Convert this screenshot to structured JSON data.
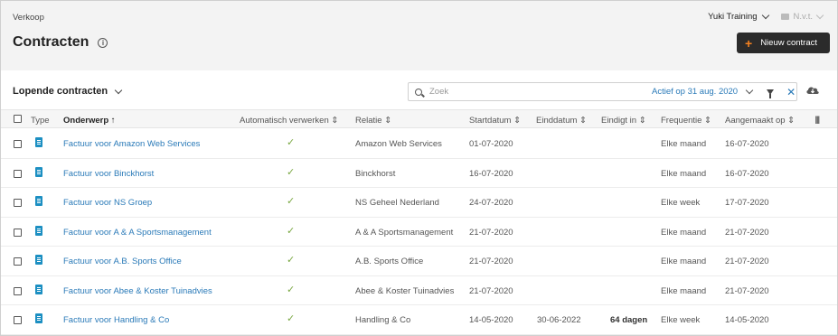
{
  "header": {
    "breadcrumb": "Verkoop",
    "title": "Contracten",
    "info_glyph": "i",
    "company": "Yuki Training",
    "period": "N.v.t.",
    "new_button": "Nieuw contract",
    "new_button_glyph": "+"
  },
  "toolbar": {
    "list_selector": "Lopende contracten",
    "search_placeholder": "Zoek",
    "active_filter": "Actief op 31 aug. 2020",
    "clear_glyph": "✕"
  },
  "table": {
    "columns": {
      "type": "Type",
      "onderwerp": "Onderwerp ↑",
      "auto": "Automatisch verwerken ⇕",
      "relatie": "Relatie ⇕",
      "start": "Startdatum ⇕",
      "eind": "Einddatum ⇕",
      "eindigt": "Eindigt in ⇕",
      "freq": "Frequentie ⇕",
      "aangemaakt": "Aangemaakt op ⇕",
      "colsel": "|||"
    },
    "check_glyph": "✓",
    "rows": [
      {
        "onderwerp": "Factuur voor Amazon Web Services",
        "relatie": "Amazon Web Services",
        "start": "01-07-2020",
        "eind": "",
        "eindigt": "",
        "freq": "Elke maand",
        "aangemaakt": "16-07-2020"
      },
      {
        "onderwerp": "Factuur voor Binckhorst",
        "relatie": "Binckhorst",
        "start": "16-07-2020",
        "eind": "",
        "eindigt": "",
        "freq": "Elke maand",
        "aangemaakt": "16-07-2020"
      },
      {
        "onderwerp": "Factuur voor NS Groep",
        "relatie": "NS Geheel Nederland",
        "start": "24-07-2020",
        "eind": "",
        "eindigt": "",
        "freq": "Elke week",
        "aangemaakt": "17-07-2020"
      },
      {
        "onderwerp": "Factuur voor A & A Sportsmanagement",
        "relatie": "A & A Sportsmanagement",
        "start": "21-07-2020",
        "eind": "",
        "eindigt": "",
        "freq": "Elke maand",
        "aangemaakt": "21-07-2020"
      },
      {
        "onderwerp": "Factuur voor A.B. Sports Office",
        "relatie": "A.B. Sports Office",
        "start": "21-07-2020",
        "eind": "",
        "eindigt": "",
        "freq": "Elke maand",
        "aangemaakt": "21-07-2020"
      },
      {
        "onderwerp": "Factuur voor Abee & Koster Tuinadvies",
        "relatie": "Abee & Koster Tuinadvies",
        "start": "21-07-2020",
        "eind": "",
        "eindigt": "",
        "freq": "Elke maand",
        "aangemaakt": "21-07-2020"
      },
      {
        "onderwerp": "Factuur voor Handling & Co",
        "relatie": "Handling & Co",
        "start": "14-05-2020",
        "eind": "30-06-2022",
        "eindigt": "64 dagen",
        "freq": "Elke week",
        "aangemaakt": "14-05-2020"
      }
    ]
  }
}
